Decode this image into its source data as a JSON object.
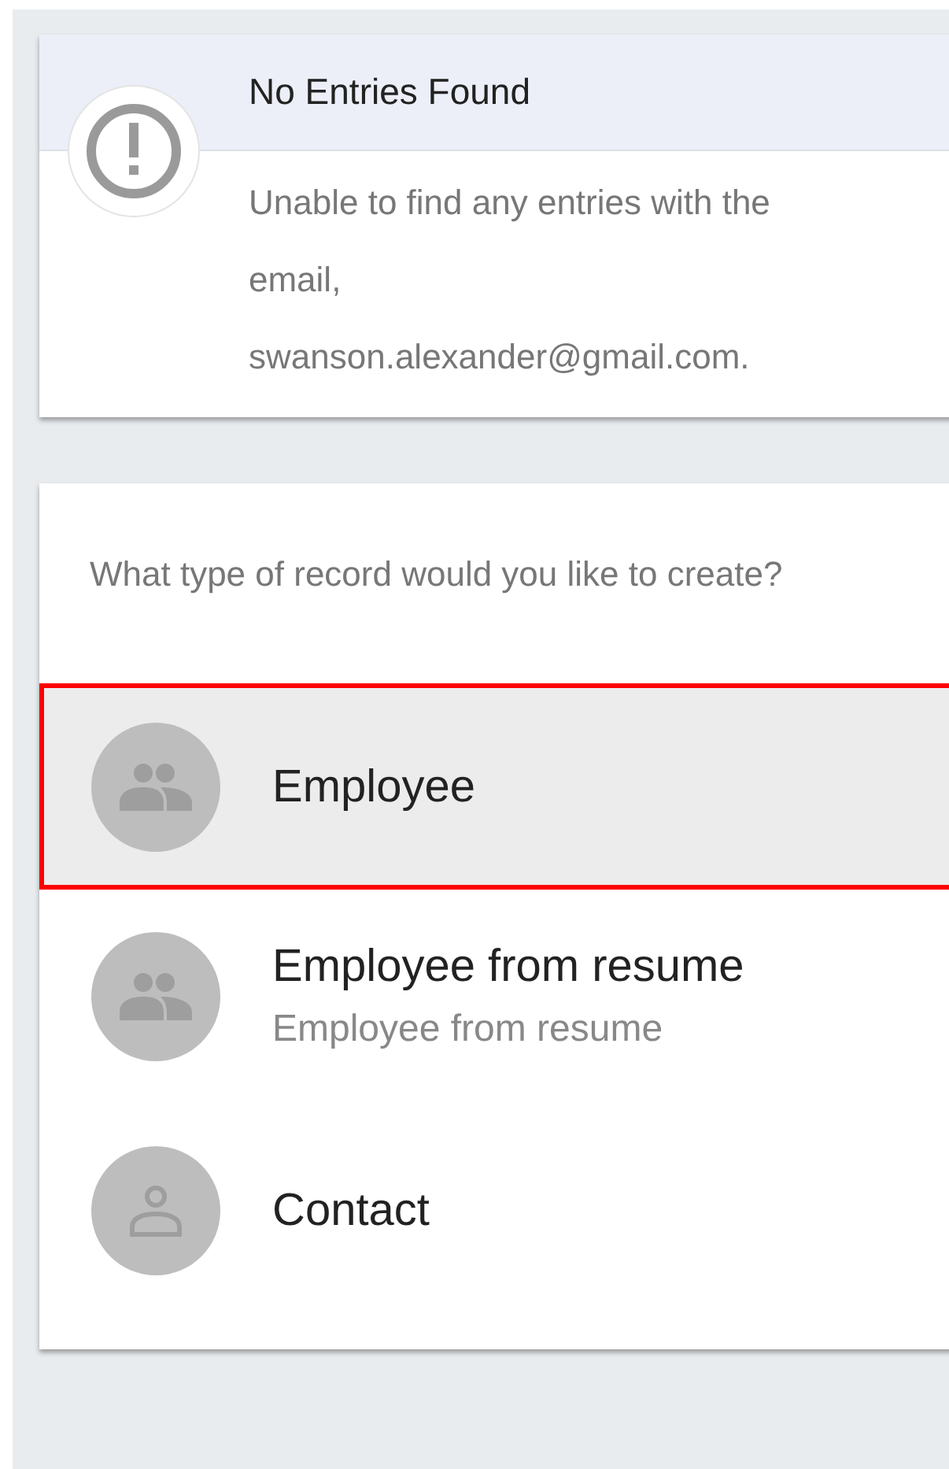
{
  "alert": {
    "title": "No Entries Found",
    "message_lines": [
      "Unable to find any entries with the",
      "email,",
      "swanson.alexander@gmail.com."
    ]
  },
  "prompt": "What type of record would you like to create?",
  "record_types": [
    {
      "kind": "group",
      "label": "Employee",
      "selected": true
    },
    {
      "kind": "group",
      "label": "Employee from resume",
      "subtitle": "Employee from resume",
      "selected": false
    },
    {
      "kind": "person",
      "label": "Contact",
      "selected": false
    }
  ]
}
